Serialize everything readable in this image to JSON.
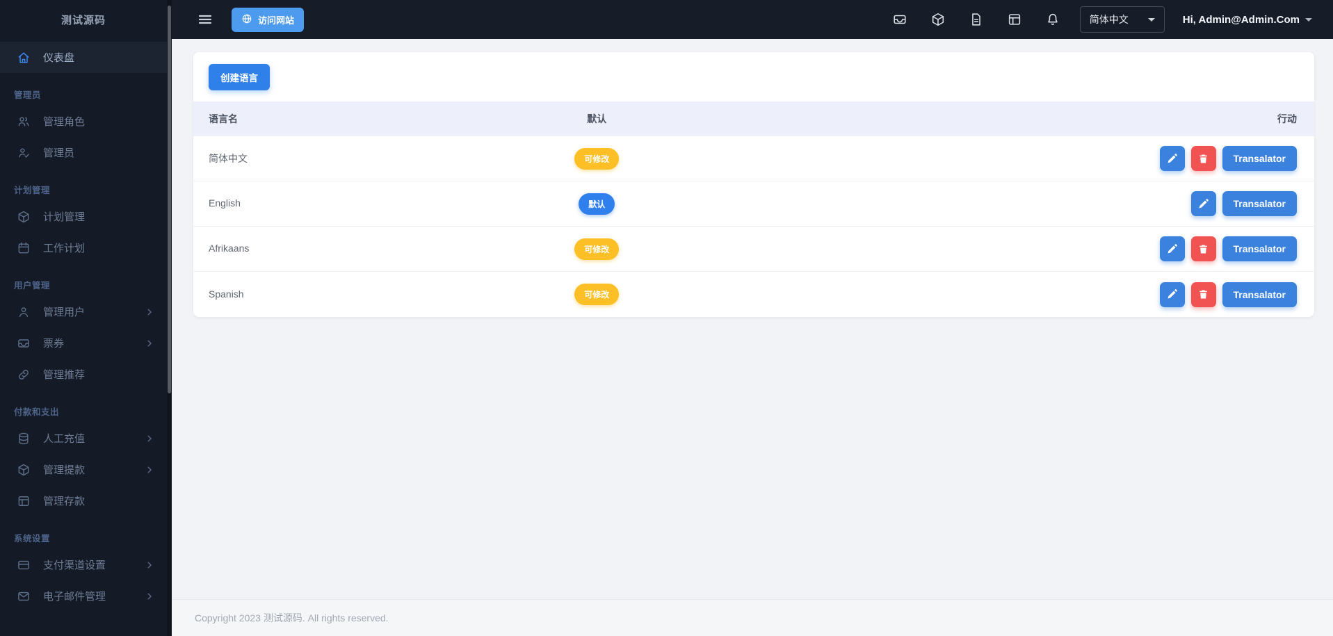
{
  "sidebar": {
    "title": "测试源码",
    "groups": [
      {
        "label": "",
        "items": [
          {
            "label": "仪表盘",
            "icon": "home",
            "active": true,
            "chevron": false
          }
        ]
      },
      {
        "label": "管理员",
        "items": [
          {
            "label": "管理角色",
            "icon": "users",
            "active": false,
            "chevron": false
          },
          {
            "label": "管理员",
            "icon": "user-check",
            "active": false,
            "chevron": false
          }
        ]
      },
      {
        "label": "计划管理",
        "items": [
          {
            "label": "计划管理",
            "icon": "cube",
            "active": false,
            "chevron": false
          },
          {
            "label": "工作计划",
            "icon": "calendar",
            "active": false,
            "chevron": false
          }
        ]
      },
      {
        "label": "用户管理",
        "items": [
          {
            "label": "管理用户",
            "icon": "user",
            "active": false,
            "chevron": true
          },
          {
            "label": "票券",
            "icon": "inbox",
            "active": false,
            "chevron": true
          },
          {
            "label": "管理推荐",
            "icon": "link",
            "active": false,
            "chevron": false
          }
        ]
      },
      {
        "label": "付款和支出",
        "items": [
          {
            "label": "人工充值",
            "icon": "database",
            "active": false,
            "chevron": true
          },
          {
            "label": "管理提款",
            "icon": "cube",
            "active": false,
            "chevron": true
          },
          {
            "label": "管理存款",
            "icon": "grid",
            "active": false,
            "chevron": false
          }
        ]
      },
      {
        "label": "系统设置",
        "items": [
          {
            "label": "支付渠道设置",
            "icon": "credit-card",
            "active": false,
            "chevron": true
          },
          {
            "label": "电子邮件管理",
            "icon": "mail",
            "active": false,
            "chevron": true
          }
        ]
      }
    ]
  },
  "navbar": {
    "visit_site_label": "访问网站",
    "quick_icons": [
      "inbox",
      "cube",
      "file",
      "grid",
      "bell"
    ],
    "language_selected": "简体中文",
    "user_greeting": "Hi, Admin@Admin.Com"
  },
  "main": {
    "create_button_label": "创建语言",
    "table": {
      "columns": [
        "语言名",
        "默认",
        "行动"
      ],
      "translator_label": "Transalator",
      "rows": [
        {
          "name": "简体中文",
          "badge": "可修改",
          "badge_type": "editable",
          "actions": [
            "edit",
            "delete",
            "translator"
          ]
        },
        {
          "name": "English",
          "badge": "默认",
          "badge_type": "default",
          "actions": [
            "edit",
            "translator"
          ]
        },
        {
          "name": "Afrikaans",
          "badge": "可修改",
          "badge_type": "editable",
          "actions": [
            "edit",
            "delete",
            "translator"
          ]
        },
        {
          "name": "Spanish",
          "badge": "可修改",
          "badge_type": "editable",
          "actions": [
            "edit",
            "delete",
            "translator"
          ]
        }
      ]
    }
  },
  "footer": {
    "text": "Copyright 2023 测试源码. All rights reserved."
  },
  "colors": {
    "sidebar_bg": "#151b26",
    "navbar_bg": "#161c28",
    "content_bg": "#f1f3f6",
    "table_header_bg": "#edf0fa",
    "accent_blue": "#3a82de",
    "create_blue": "#2f80e8",
    "visit_blue": "#4c9bee",
    "danger_red": "#f05352",
    "warning_yellow": "#fcbf25",
    "default_badge_blue": "#2f80ed"
  }
}
